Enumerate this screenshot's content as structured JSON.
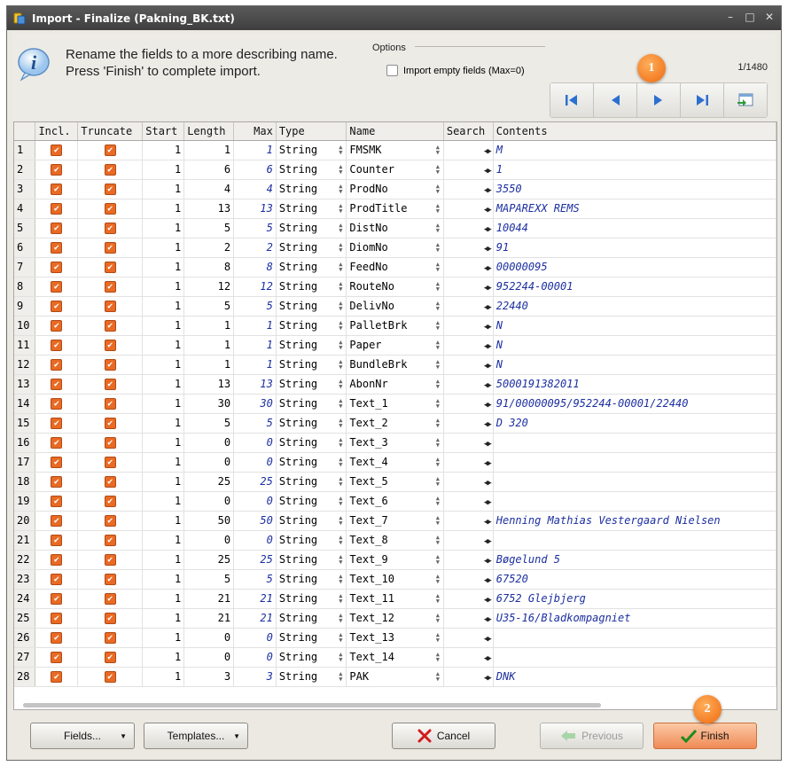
{
  "window": {
    "title": "Import - Finalize  (Pakning_BK.txt)"
  },
  "header": {
    "line1": "Rename the fields to a more describing name.",
    "line2": "Press 'Finish' to complete import.",
    "options_legend": "Options",
    "import_empty_label": "Import empty fields (Max=0)",
    "import_empty_checked": false,
    "counter": "1/1480"
  },
  "badges": {
    "one": "1",
    "two": "2"
  },
  "columns": [
    "",
    "Incl.",
    "Truncate",
    "Start",
    "Length",
    "Max",
    "Type",
    "Name",
    "Search",
    "Contents"
  ],
  "rows": [
    {
      "n": "1",
      "start": "1",
      "length": "1",
      "max": "1",
      "type": "String",
      "name": "FMSMK",
      "contents": "M"
    },
    {
      "n": "2",
      "start": "1",
      "length": "6",
      "max": "6",
      "type": "String",
      "name": "Counter",
      "contents": "1"
    },
    {
      "n": "3",
      "start": "1",
      "length": "4",
      "max": "4",
      "type": "String",
      "name": "ProdNo",
      "contents": "3550"
    },
    {
      "n": "4",
      "start": "1",
      "length": "13",
      "max": "13",
      "type": "String",
      "name": "ProdTitle",
      "contents": "MAPAREXX REMS"
    },
    {
      "n": "5",
      "start": "1",
      "length": "5",
      "max": "5",
      "type": "String",
      "name": "DistNo",
      "contents": "10044"
    },
    {
      "n": "6",
      "start": "1",
      "length": "2",
      "max": "2",
      "type": "String",
      "name": "DiomNo",
      "contents": "91"
    },
    {
      "n": "7",
      "start": "1",
      "length": "8",
      "max": "8",
      "type": "String",
      "name": "FeedNo",
      "contents": "00000095"
    },
    {
      "n": "8",
      "start": "1",
      "length": "12",
      "max": "12",
      "type": "String",
      "name": "RouteNo",
      "contents": "952244-00001"
    },
    {
      "n": "9",
      "start": "1",
      "length": "5",
      "max": "5",
      "type": "String",
      "name": "DelivNo",
      "contents": "22440"
    },
    {
      "n": "10",
      "start": "1",
      "length": "1",
      "max": "1",
      "type": "String",
      "name": "PalletBrk",
      "contents": "N"
    },
    {
      "n": "11",
      "start": "1",
      "length": "1",
      "max": "1",
      "type": "String",
      "name": "Paper",
      "contents": "N"
    },
    {
      "n": "12",
      "start": "1",
      "length": "1",
      "max": "1",
      "type": "String",
      "name": "BundleBrk",
      "contents": "N"
    },
    {
      "n": "13",
      "start": "1",
      "length": "13",
      "max": "13",
      "type": "String",
      "name": "AbonNr",
      "contents": "5000191382011"
    },
    {
      "n": "14",
      "start": "1",
      "length": "30",
      "max": "30",
      "type": "String",
      "name": "Text_1",
      "contents": "91/00000095/952244-00001/22440"
    },
    {
      "n": "15",
      "start": "1",
      "length": "5",
      "max": "5",
      "type": "String",
      "name": "Text_2",
      "contents": "D 320"
    },
    {
      "n": "16",
      "start": "1",
      "length": "0",
      "max": "0",
      "type": "String",
      "name": "Text_3",
      "contents": ""
    },
    {
      "n": "17",
      "start": "1",
      "length": "0",
      "max": "0",
      "type": "String",
      "name": "Text_4",
      "contents": ""
    },
    {
      "n": "18",
      "start": "1",
      "length": "25",
      "max": "25",
      "type": "String",
      "name": "Text_5",
      "contents": ""
    },
    {
      "n": "19",
      "start": "1",
      "length": "0",
      "max": "0",
      "type": "String",
      "name": "Text_6",
      "contents": ""
    },
    {
      "n": "20",
      "start": "1",
      "length": "50",
      "max": "50",
      "type": "String",
      "name": "Text_7",
      "contents": "Henning Mathias Vestergaard Nielsen"
    },
    {
      "n": "21",
      "start": "1",
      "length": "0",
      "max": "0",
      "type": "String",
      "name": "Text_8",
      "contents": ""
    },
    {
      "n": "22",
      "start": "1",
      "length": "25",
      "max": "25",
      "type": "String",
      "name": "Text_9",
      "contents": "Bøgelund 5"
    },
    {
      "n": "23",
      "start": "1",
      "length": "5",
      "max": "5",
      "type": "String",
      "name": "Text_10",
      "contents": "67520"
    },
    {
      "n": "24",
      "start": "1",
      "length": "21",
      "max": "21",
      "type": "String",
      "name": "Text_11",
      "contents": "6752 Glejbjerg"
    },
    {
      "n": "25",
      "start": "1",
      "length": "21",
      "max": "21",
      "type": "String",
      "name": "Text_12",
      "contents": "U35-16/Bladkompagniet"
    },
    {
      "n": "26",
      "start": "1",
      "length": "0",
      "max": "0",
      "type": "String",
      "name": "Text_13",
      "contents": ""
    },
    {
      "n": "27",
      "start": "1",
      "length": "0",
      "max": "0",
      "type": "String",
      "name": "Text_14",
      "contents": ""
    },
    {
      "n": "28",
      "start": "1",
      "length": "3",
      "max": "3",
      "type": "String",
      "name": "PAK",
      "contents": "DNK"
    }
  ],
  "footer": {
    "fields_label": "Fields...",
    "templates_label": "Templates...",
    "cancel_label": "Cancel",
    "previous_label": "Previous",
    "finish_label": "Finish"
  },
  "colors": {
    "accent": "#e86a24",
    "value_blue": "#1c2fa0"
  }
}
